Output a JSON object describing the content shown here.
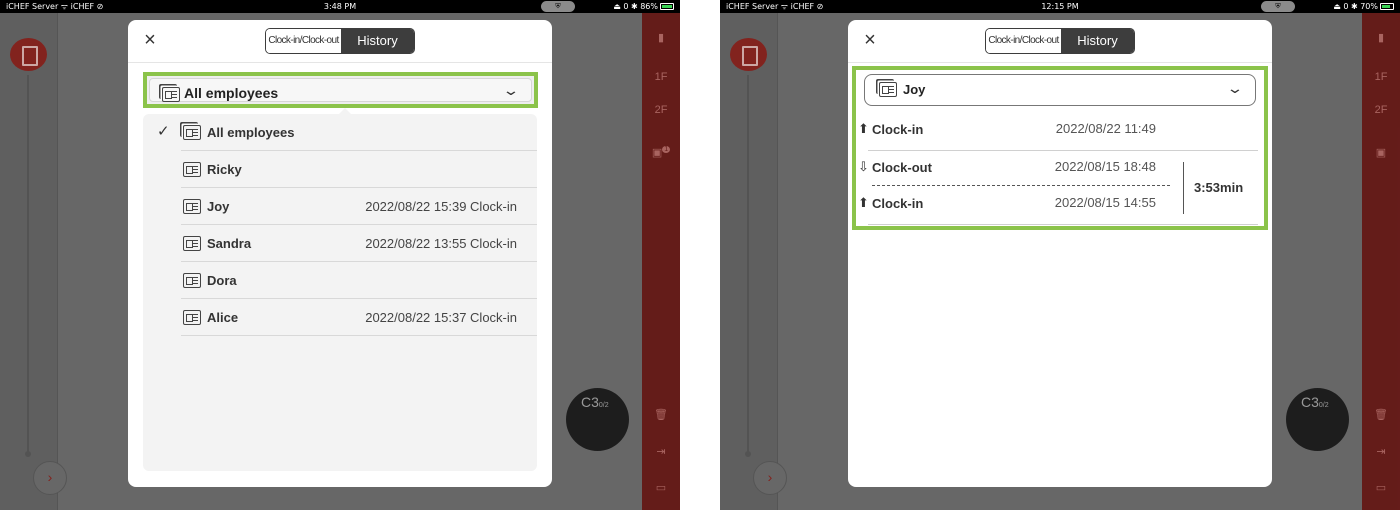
{
  "left": {
    "status": {
      "left": "iCHEF Server  ᯤ iCHEF  ⊘",
      "time": "3:48 PM",
      "pill": "⛨",
      "right": "⏏ 0 ✱ 86%"
    },
    "modal": {
      "close": "×",
      "tabs": {
        "clock": "Clock-in/Clock-out",
        "history": "History"
      },
      "dropdown": {
        "selected": "All employees"
      },
      "list": [
        {
          "name": "All employees",
          "time": "",
          "checked": "✓"
        },
        {
          "name": "Ricky",
          "time": ""
        },
        {
          "name": "Joy",
          "time": "2022/08/22 15:39 Clock-in"
        },
        {
          "name": "Sandra",
          "time": "2022/08/22 13:55 Clock-in"
        },
        {
          "name": "Dora",
          "time": ""
        },
        {
          "name": "Alice",
          "time": "2022/08/22 15:37 Clock-in"
        }
      ]
    },
    "side": {
      "floors": [
        "1F",
        "2F"
      ],
      "badge": "1",
      "table": {
        "name": "C3",
        "cap": "0/2"
      },
      "expand": "›"
    }
  },
  "right": {
    "status": {
      "left": "iCHEF Server  ᯤ iCHEF  ⊘",
      "time": "12:15 PM",
      "pill": "⛨",
      "right": "⏏ 0 ✱ 70%"
    },
    "modal": {
      "close": "×",
      "tabs": {
        "clock": "Clock-in/Clock-out",
        "history": "History"
      },
      "dropdown": {
        "selected": "Joy"
      },
      "records": [
        {
          "arrow": "⬆",
          "label": "Clock-in",
          "time": "2022/08/22 11:49"
        },
        {
          "arrow": "⇩",
          "label": "Clock-out",
          "time": "2022/08/15 18:48"
        },
        {
          "arrow": "⬆",
          "label": "Clock-in",
          "time": "2022/08/15 14:55"
        }
      ],
      "duration": "3:53min"
    },
    "side": {
      "floors": [
        "1F",
        "2F"
      ],
      "table": {
        "name": "C3",
        "cap": "0/2"
      },
      "expand": "›"
    }
  },
  "colors": {
    "accent_green": "#8bc34a",
    "brand_red": "#8a2520",
    "overlay_gray": "#6d6d6d"
  },
  "icons": [
    "employee-card-icon",
    "employees-stack-icon",
    "checkmark-icon",
    "close-icon",
    "chevron-down-icon",
    "arrow-up-icon",
    "arrow-down-icon",
    "trash-icon",
    "logout-icon",
    "briefcase-icon"
  ]
}
